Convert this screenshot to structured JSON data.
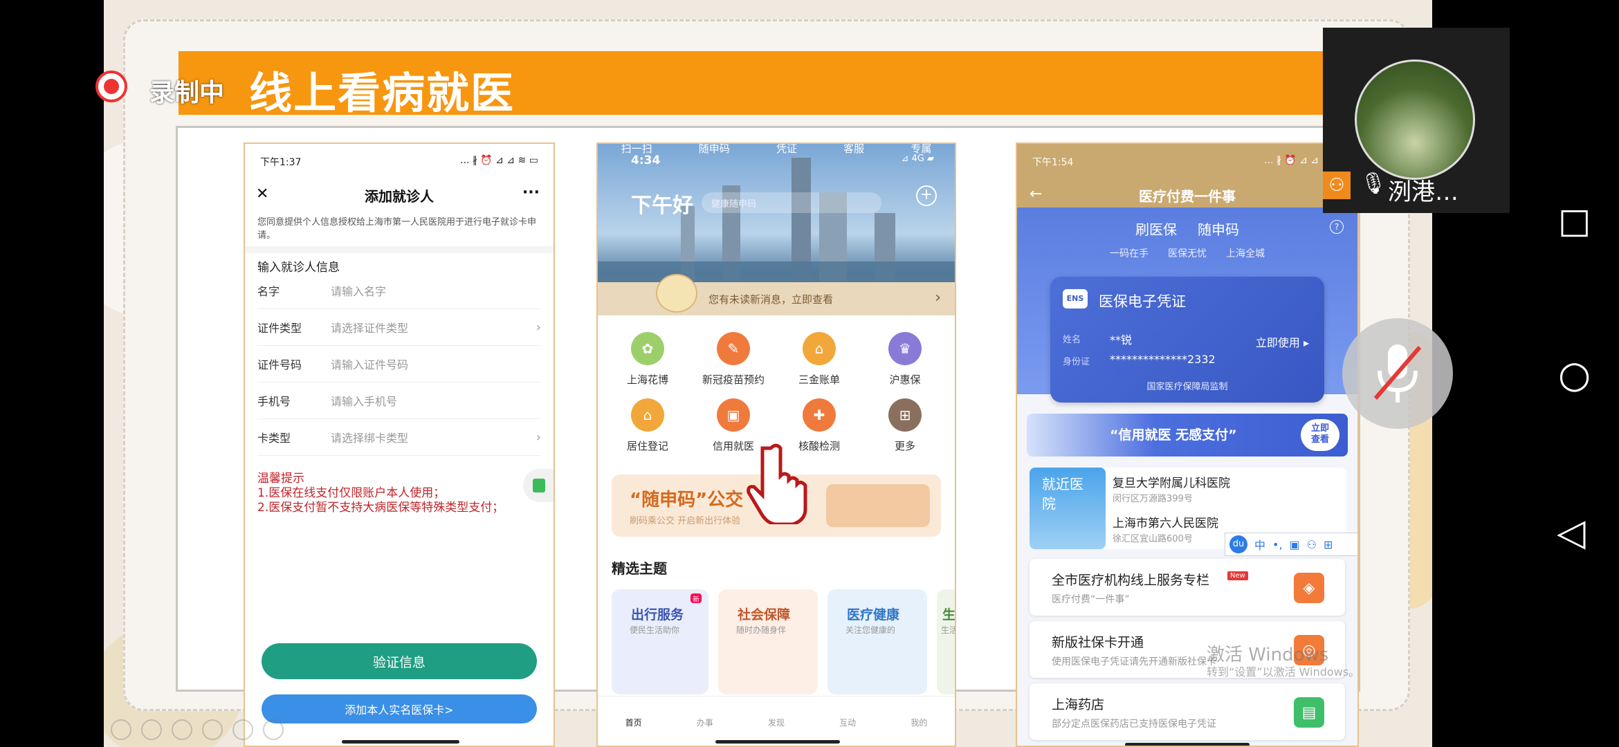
{
  "recording": {
    "label": "录制中"
  },
  "slide": {
    "title": "线上看病就医"
  },
  "phone1": {
    "time": "下午1:37",
    "status_icons": "... ∦ ⏰ ⊿ ⊿ ≋ ▭",
    "nav_title": "添加就诊人",
    "close_icon": "✕",
    "more_icon": "···",
    "consent": "您同意提供个人信息授权给上海市第一人民医院用于进行电子就诊卡申请。",
    "section": "输入就诊人信息",
    "fields": [
      {
        "label": "名字",
        "placeholder": "请输入名字",
        "chevron": ""
      },
      {
        "label": "证件类型",
        "placeholder": "请选择证件类型",
        "chevron": "›"
      },
      {
        "label": "证件号码",
        "placeholder": "请输入证件号码",
        "chevron": ""
      },
      {
        "label": "手机号",
        "placeholder": "请输入手机号",
        "chevron": ""
      },
      {
        "label": "卡类型",
        "placeholder": "请选择绑卡类型",
        "chevron": "›"
      }
    ],
    "tips_title": "温馨提示",
    "tips": [
      "1.医保在线支付仅限账户本人使用；",
      "2.医保支付暂不支持大病医保等特殊类型支付；"
    ],
    "verify_button": "验证信息",
    "add_card_button": "添加本人实名医保卡>"
  },
  "phone2": {
    "top_tabs": [
      "扫一扫",
      "随申码",
      "凭证",
      "客服",
      "专属"
    ],
    "time": "4:34",
    "status": "⊿ 4G ▰",
    "greeting": "下午好",
    "search_placeholder": "健康随申码",
    "notice": "您有未读新消息，立即查看",
    "notice_arrow": "›",
    "services_row1": [
      {
        "label": "上海花博",
        "color": "#9ccf6a",
        "glyph": "✿"
      },
      {
        "label": "新冠疫苗预约",
        "color": "#f07a3c",
        "glyph": "✎"
      },
      {
        "label": "三金账单",
        "color": "#f2a73b",
        "glyph": "⌂"
      },
      {
        "label": "沪惠保",
        "color": "#8a7ad8",
        "glyph": "♛"
      }
    ],
    "services_row2": [
      {
        "label": "居住登记",
        "color": "#f2a73b",
        "glyph": "⌂"
      },
      {
        "label": "信用就医",
        "color": "#f07a3c",
        "glyph": "▣"
      },
      {
        "label": "核酸检测",
        "color": "#f07a3c",
        "glyph": "✚"
      },
      {
        "label": "更多",
        "color": "#8b6f5e",
        "glyph": "⊞"
      }
    ],
    "banner_title": "“随申码”公交",
    "banner_sub": "刷码乘公交 开启新出行体验",
    "section_title": "精选主题",
    "themes": [
      {
        "title": "出行服务",
        "sub": "便民生活助你",
        "badge": "新"
      },
      {
        "title": "社会保障",
        "sub": "随时办随身伴",
        "badge": ""
      },
      {
        "title": "医疗健康",
        "sub": "关注您健康的",
        "badge": ""
      },
      {
        "title": "生",
        "sub": "生活",
        "badge": ""
      }
    ],
    "tabbar": [
      "首页",
      "办事",
      "发现",
      "互动",
      "我的"
    ]
  },
  "phone3": {
    "time": "下午1:54",
    "status_icons": "... ∦ ⏰ ⊿ ⊿ ≋ ▭",
    "nav_title": "医疗付费一件事",
    "back_icon": "←",
    "header_tabs": [
      "刷医保",
      "随申码"
    ],
    "help_icon": "?",
    "slogans": [
      "一码在手",
      "医保无忧",
      "上海全城"
    ],
    "card": {
      "logo_text": "ENS",
      "title": "医保电子凭证",
      "name_label": "姓名",
      "name_value": "**锐",
      "use_now": "立即使用 ▸",
      "id_label": "身份证",
      "id_value": "**************2332",
      "footer": "国家医疗保障局监制"
    },
    "promo": {
      "text": "“信用就医 无感支付”",
      "button": "立即查看"
    },
    "nearby_label": "就近医院",
    "hospitals": [
      {
        "name": "复旦大学附属儿科医院",
        "addr": "闵行区万源路399号"
      },
      {
        "name": "上海市第六人民医院",
        "addr": "徐汇区宜山路600号"
      }
    ],
    "ime": {
      "brand": "du",
      "mode": "中"
    },
    "services": [
      {
        "title": "全市医疗机构线上服务专栏",
        "badge": "New",
        "sub": "医疗付费“一件事”",
        "color": "#f27b3a",
        "glyph": "◈"
      },
      {
        "title": "新版社保卡开通",
        "badge": "",
        "sub": "使用医保电子凭证请先开通新版社保卡",
        "color": "#f27b3a",
        "glyph": "◎"
      },
      {
        "title": "上海药店",
        "badge": "",
        "sub": "部分定点医保药店已支持医保电子凭证",
        "color": "#3fbf6a",
        "glyph": "▤"
      }
    ]
  },
  "windows_watermark": {
    "line1": "激活 Windows",
    "line2": "转到“设置”以激活 Windows。"
  },
  "participant": {
    "name": "洌港…"
  },
  "android_nav": {
    "recent": "□",
    "home": "○",
    "back": "◁"
  }
}
